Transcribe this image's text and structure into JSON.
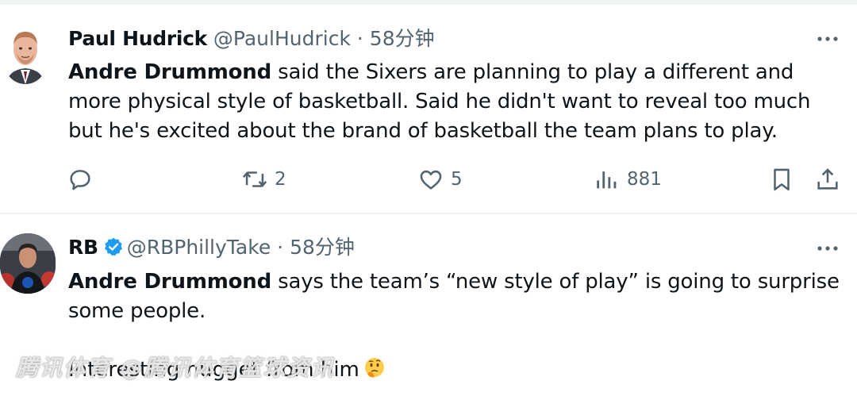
{
  "tweets": [
    {
      "name": "Paul Hudrick",
      "handle": "@PaulHudrick",
      "separator": "·",
      "time": "58分钟",
      "text_bold": "Andre Drummond",
      "text_rest": " said the Sixers are planning to play a different and more physical style of basketball. Said he didn't want to reveal too much but he's excited about the brand of basketball the team plans to play.",
      "actions": {
        "reply": "",
        "retweet": "2",
        "like": "5",
        "views": "881"
      }
    },
    {
      "name": "RB",
      "handle": "@RBPhillyTake",
      "separator": "·",
      "time": "58分钟",
      "text_bold": "Andre Drummond",
      "text_rest": " says the team’s “new style of play” is going to surprise some people.",
      "last_line": "Interesting nugget from him"
    }
  ],
  "watermark": "腾讯体育 @腾讯体育篮球资讯",
  "icons": {
    "verified": "verified-badge-icon",
    "more": "more-options-icon",
    "reply": "reply-icon",
    "retweet": "retweet-icon",
    "like": "heart-icon",
    "views": "views-icon",
    "bookmark": "bookmark-icon",
    "share": "share-icon",
    "emoji": "thinking-face-icon"
  },
  "colors": {
    "verified": "#1d9bf0",
    "secondary_text": "#536471",
    "divider": "#eff3f4"
  }
}
